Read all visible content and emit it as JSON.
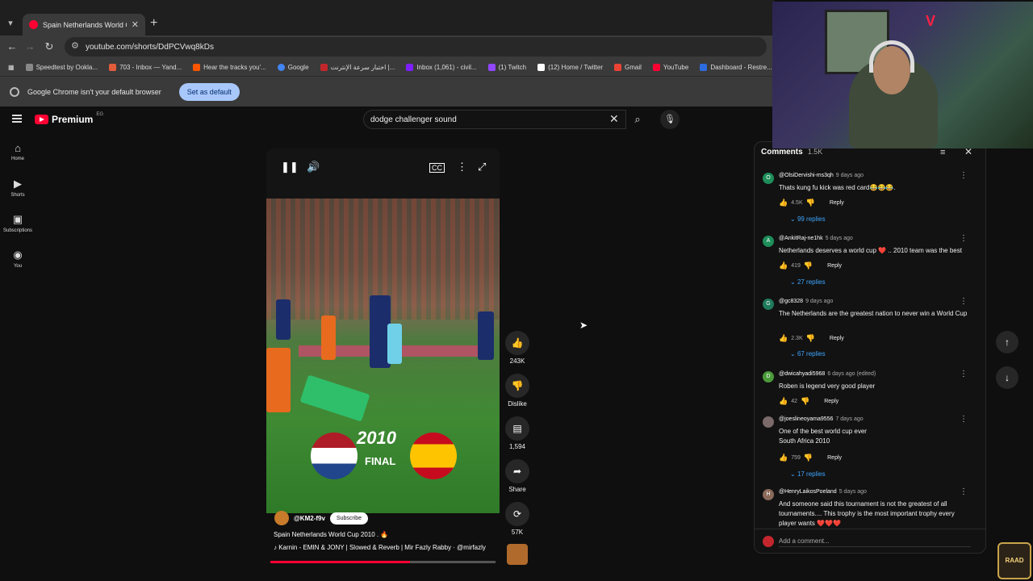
{
  "browser": {
    "tab_title": "Spain Netherlands World C",
    "url": "youtube.com/shorts/DdPCVwq8kDs",
    "bookmarks": [
      "Speedtest by Ookla...",
      "703 - Inbox — Yand...",
      "Hear the tracks you'...",
      "Google",
      "اختبار سرعة الإنترنت |...",
      "Inbox (1,061) - civil...",
      "(1) Twitch",
      "(12) Home / Twitter",
      "Gmail",
      "YouTube",
      "Dashboard - Restre..."
    ],
    "infobar_text": "Google Chrome isn't your default browser",
    "set_default_label": "Set as default"
  },
  "youtube": {
    "brand": "Premium",
    "region": "EG",
    "search_value": "dodge challenger sound",
    "sidebar": [
      {
        "label": "Home",
        "icon": "home-icon"
      },
      {
        "label": "Shorts",
        "icon": "shorts-icon"
      },
      {
        "label": "Subscriptions",
        "icon": "subscriptions-icon"
      },
      {
        "label": "You",
        "icon": "you-icon"
      }
    ]
  },
  "video": {
    "overlay_year": "2010",
    "overlay_final": "FINAL",
    "channel": "@KM2-f9v",
    "subscribe_label": "Subscribe",
    "title": "Spain Netherlands World Cup 2010 . 🔥",
    "music": "♪ Karnin - EMIN & JONY | Slowed & Reverb | Mir Fazly Rabby · @mirfazly",
    "progress": 0.62
  },
  "actions": {
    "likes": "243K",
    "dislike_label": "Dislike",
    "comments": "1,594",
    "share_label": "Share",
    "remix": "57K"
  },
  "comments_panel": {
    "title": "Comments",
    "count": "1.5K",
    "add_placeholder": "Add a comment...",
    "items": [
      {
        "initial": "O",
        "color": "#1e8e5a",
        "author": "@OlsiDervishi-ms3qh",
        "ago": "9 days ago",
        "text": "Thats kung fu kick was red card😂😂😂.",
        "likes": "4.5K",
        "replies": "99 replies"
      },
      {
        "initial": "A",
        "color": "#1e8e5a",
        "author": "@AnkitRaj-ne1hk",
        "ago": "5 days ago",
        "text": "Netherlands deserves a world cup ❤️ .. 2010 team was the best",
        "likes": "419",
        "replies": "27 replies"
      },
      {
        "initial": "G",
        "color": "#1e7a5a",
        "author": "@gc8328",
        "ago": "9 days ago",
        "text": "The Netherlands are the greatest nation to never win a World Cup",
        "likes": "2.3K",
        "replies": "67 replies"
      },
      {
        "initial": "D",
        "color": "#4a9a3a",
        "author": "@dwicahyadi5968",
        "ago": "6 days ago (edited)",
        "text": "Roben is legend very good player",
        "likes": "42",
        "replies": ""
      },
      {
        "initial": "",
        "color": "#7a6a6a",
        "author": "@joeslineoyama9556",
        "ago": "7 days ago",
        "text": "One of the best world cup ever South Africa 2010",
        "likes": "759",
        "replies": "17 replies"
      },
      {
        "initial": "H",
        "color": "#8a6a5a",
        "author": "@HenryLaikosPoeland",
        "ago": "5 days ago",
        "text": "And someone said this tournament is not the greatest of all tournaments.... This trophy is the most important trophy every player wants ❤️❤️❤️",
        "likes": "",
        "replies": ""
      }
    ],
    "reply_label": "Reply"
  },
  "overlay": {
    "streamer_badge": "RAAD"
  }
}
